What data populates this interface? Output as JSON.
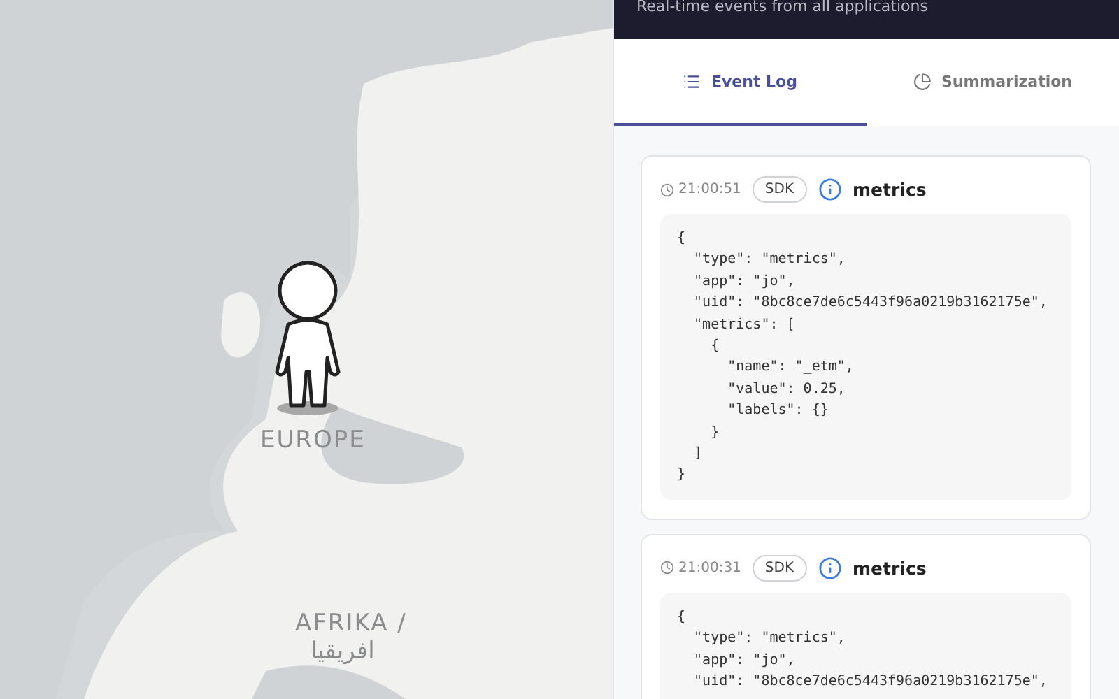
{
  "map": {
    "labels": [
      {
        "kind": "region",
        "text": "EUROPE"
      },
      {
        "kind": "region",
        "text": "AFRIKA /"
      },
      {
        "kind": "region",
        "text": "افريقيا"
      }
    ]
  },
  "panel": {
    "subtitle": "Real-time events from all applications",
    "tabs": [
      {
        "label": "Event Log",
        "kind": "log",
        "selected": true
      },
      {
        "label": "Summarization",
        "kind": "summary",
        "selected": false
      }
    ],
    "events": [
      {
        "time": "21:00:51",
        "source": "SDK",
        "name": "metrics",
        "body": "{\n  \"type\": \"metrics\",\n  \"app\": \"jo\",\n  \"uid\": \"8bc8ce7de6c5443f96a0219b3162175e\",\n  \"metrics\": [\n    {\n      \"name\": \"_etm\",\n      \"value\": 0.25,\n      \"labels\": {}\n    }\n  ]\n}"
      },
      {
        "time": "21:00:31",
        "source": "SDK",
        "name": "metrics",
        "body": "{\n  \"type\": \"metrics\",\n  \"app\": \"jo\",\n  \"uid\": \"8bc8ce7de6c5443f96a0219b3162175e\","
      }
    ]
  }
}
